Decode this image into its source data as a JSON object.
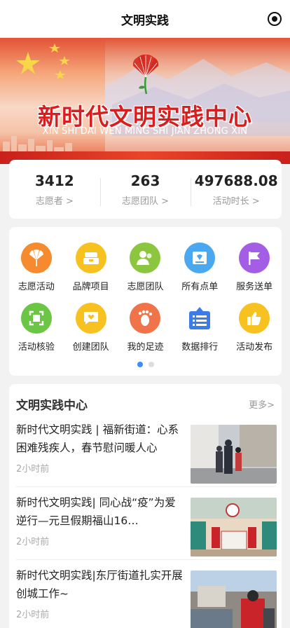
{
  "navbar": {
    "title": "文明实践"
  },
  "banner": {
    "headline": "新时代文明实践中心",
    "pinyin": "XIN SHI DAI WEN MING SHI JIAN ZHONG XIN"
  },
  "stats": [
    {
      "value": "3412",
      "label": "志愿者 >"
    },
    {
      "value": "263",
      "label": "志愿团队 >"
    },
    {
      "value": "497688.08",
      "label": "活动时长 >"
    }
  ],
  "grid": {
    "row1": [
      {
        "label": "志愿活动",
        "icon": "volunteer-activity-icon",
        "color": "#f58a2e"
      },
      {
        "label": "品牌项目",
        "icon": "brand-project-icon",
        "color": "#f7c21f"
      },
      {
        "label": "志愿团队",
        "icon": "volunteer-team-icon",
        "color": "#8cc63e"
      },
      {
        "label": "所有点单",
        "icon": "all-orders-icon",
        "color": "#4aa8f0"
      },
      {
        "label": "服务送单",
        "icon": "service-delivery-icon",
        "color": "#a45ee5"
      }
    ],
    "row2": [
      {
        "label": "活动核验",
        "icon": "activity-verify-icon",
        "color": "#6cc645"
      },
      {
        "label": "创建团队",
        "icon": "create-team-icon",
        "color": "#f7c21f"
      },
      {
        "label": "我的足迹",
        "icon": "footprint-icon",
        "color": "#f0734a"
      },
      {
        "label": "数据排行",
        "icon": "data-ranking-icon",
        "color": "#3a7ce8"
      },
      {
        "label": "活动发布",
        "icon": "activity-publish-icon",
        "color": "#f7c21f"
      }
    ],
    "page_indicator": {
      "pages": 2,
      "current": 1
    }
  },
  "news": {
    "heading": "文明实践中心",
    "more": "更多>",
    "items": [
      {
        "title": "新时代文明实践 | 福新街道：心系困难残疾人，春节慰问暖人心",
        "time": "2小时前"
      },
      {
        "title": "新时代文明实践| 同心战“疫”为爱逆行—元旦假期福山16…",
        "time": "2小时前"
      },
      {
        "title": "新时代文明实践|东厅街道扎实开展创城工作~",
        "time": "2小时前"
      }
    ]
  }
}
